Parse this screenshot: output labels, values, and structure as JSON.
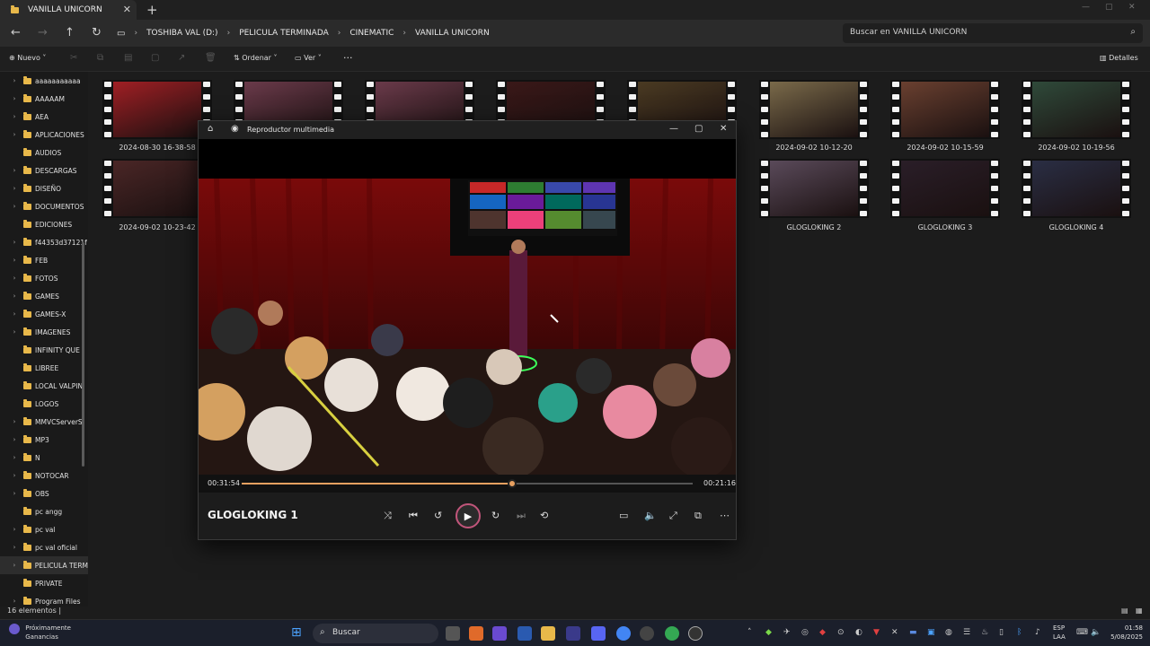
{
  "window": {
    "tab_label": "VANILLA UNICORN",
    "tab_close": "✕",
    "new_tab": "+"
  },
  "address": {
    "crumbs": [
      "TOSHIBA VAL (D:)",
      "PELICULA TERMINADA",
      "CINEMATIC",
      "VANILLA UNICORN"
    ],
    "search_placeholder": "Buscar en VANILLA UNICORN"
  },
  "toolbar": {
    "new_label": "Nuevo",
    "sort_label": "Ordenar",
    "view_label": "Ver",
    "more_label": "···",
    "details_label": "Detalles"
  },
  "sidebar": {
    "items": [
      {
        "label": "aaaaaaaaaaa",
        "expandable": true
      },
      {
        "label": "AAAAAM",
        "expandable": true
      },
      {
        "label": "AEA",
        "expandable": true
      },
      {
        "label": "APLICACIONES",
        "expandable": true
      },
      {
        "label": "AUDIOS",
        "expandable": false
      },
      {
        "label": "DESCARGAS",
        "expandable": true
      },
      {
        "label": "DISEÑO",
        "expandable": true
      },
      {
        "label": "DOCUMENTOS",
        "expandable": true
      },
      {
        "label": "EDICIONES",
        "expandable": false
      },
      {
        "label": "f44353d37121f",
        "expandable": true
      },
      {
        "label": "FEB",
        "expandable": true
      },
      {
        "label": "FOTOS",
        "expandable": true
      },
      {
        "label": "GAMES",
        "expandable": true
      },
      {
        "label": "GAMES-X",
        "expandable": true
      },
      {
        "label": "IMAGENES",
        "expandable": true
      },
      {
        "label": "INFINITY QUE",
        "expandable": false
      },
      {
        "label": "LIBREE",
        "expandable": false
      },
      {
        "label": "LOCAL VALPIN",
        "expandable": false
      },
      {
        "label": "LOGOS",
        "expandable": false
      },
      {
        "label": "MMVCServerSI",
        "expandable": true
      },
      {
        "label": "MP3",
        "expandable": true
      },
      {
        "label": "N",
        "expandable": true
      },
      {
        "label": "NOTOCAR",
        "expandable": true
      },
      {
        "label": "OBS",
        "expandable": true
      },
      {
        "label": "pc angg",
        "expandable": false
      },
      {
        "label": "pc val",
        "expandable": true
      },
      {
        "label": "pc val oficial",
        "expandable": true
      },
      {
        "label": "PELICULA TERM",
        "expandable": true,
        "selected": true
      },
      {
        "label": "PRIVATE",
        "expandable": false
      },
      {
        "label": "Program Files",
        "expandable": true
      }
    ]
  },
  "files": [
    {
      "label": "",
      "color": "#a01f24"
    },
    {
      "label": "",
      "color": "#6a3a4a"
    },
    {
      "label": "",
      "color": "#6a3a4a"
    },
    {
      "label": "",
      "color": "#3a1818"
    },
    {
      "label": "",
      "color": "#4a3a22"
    },
    {
      "label": "2024-09-02 10-12-20",
      "color": "#7a6a4a"
    },
    {
      "label": "2024-09-02 10-15-59",
      "color": "#6a4030"
    },
    {
      "label": "2024-09-02 10-19-56",
      "color": "#2f4a3a"
    },
    {
      "label": "2024-08-30 16-38-58",
      "color": "#8a2020"
    },
    {
      "label": "2024-09-02 10-23-42",
      "color": "#4a2626"
    },
    {
      "label": "GLOGLOKING 2",
      "color": "#5a4a5a"
    },
    {
      "label": "GLOGLOKING 3",
      "color": "#2a1e28"
    },
    {
      "label": "GLOGLOKING 4",
      "color": "#2a2e44"
    }
  ],
  "player": {
    "app_title": "Reproductor multimedia",
    "media_title": "GLOGLOKING 1",
    "elapsed": "00:31:54",
    "remaining": "00:21:16",
    "progress": 0.6,
    "accent": "#e8a060"
  },
  "status": {
    "count": "16 elementos  |"
  },
  "taskbar": {
    "widget_line1": "Próximamente",
    "widget_line2": "Ganancias",
    "search_label": "Buscar",
    "lang_line1": "ESP",
    "lang_line2": "LAA",
    "time": "01:58",
    "date": "5/08/2025"
  }
}
